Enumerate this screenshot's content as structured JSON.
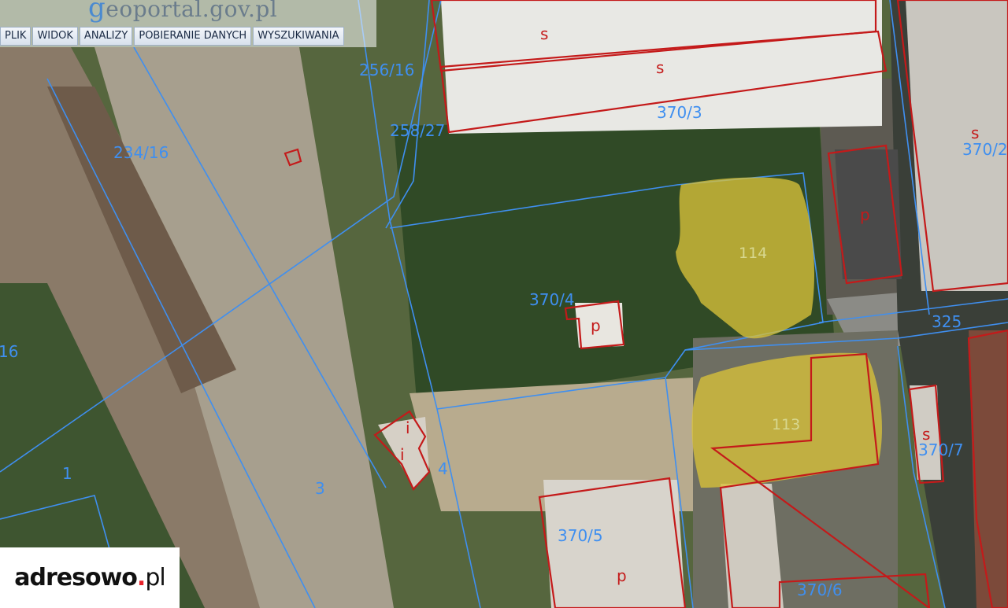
{
  "app": {
    "logo_text": "eoportal.gov.pl",
    "logo_initial": "g"
  },
  "menu": [
    {
      "label": "PLIK"
    },
    {
      "label": "WIDOK"
    },
    {
      "label": "ANALIZY"
    },
    {
      "label": "POBIERANIE DANYCH"
    },
    {
      "label": "WYSZUKIWANIA"
    }
  ],
  "parcels": {
    "p256_16": "256/16",
    "p258_27": "258/27",
    "p234_16": "234/16",
    "p370_3": "370/3",
    "p370_2": "370/2",
    "p370_4": "370/4",
    "p325": "325",
    "p370_7": "370/7",
    "p370_5": "370/5",
    "p370_6": "370/6",
    "p16": "16",
    "p1": "1",
    "p3": "3",
    "p4": "4"
  },
  "buildings": {
    "s_top1": "s",
    "s_top2": "s",
    "s_right": "s",
    "p_right": "p",
    "p_center": "p",
    "s_small": "s",
    "i_1": "i",
    "i_2": "i",
    "p_bottom": "p"
  },
  "highlights": {
    "h114": "114",
    "h113": "113"
  },
  "watermark": {
    "name": "adresowo",
    "dot": ".",
    "tld": "pl"
  },
  "colors": {
    "parcel_line": "#3f8ff0",
    "building_line": "#c41a1a",
    "highlight_fill": "#d8c23a"
  }
}
